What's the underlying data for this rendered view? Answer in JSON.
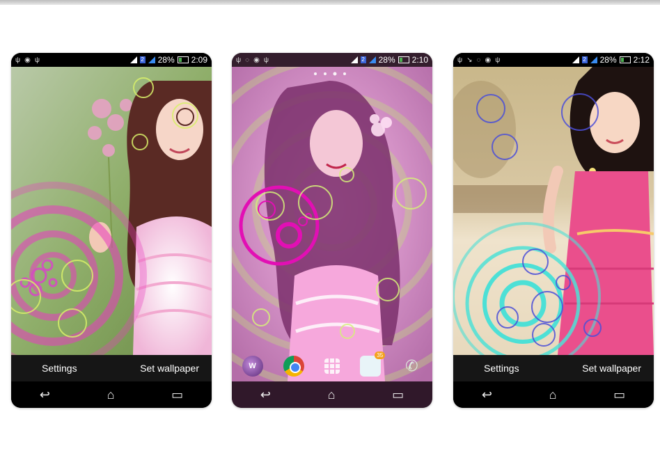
{
  "screens": [
    {
      "time": "2:09",
      "battery": "28%",
      "sim": "2",
      "actions": {
        "settings": "Settings",
        "set_wallpaper": "Set wallpaper"
      }
    },
    {
      "time": "2:10",
      "battery": "28%",
      "sim": "2",
      "dock": {
        "walkman": "W",
        "messaging_badge": "35"
      }
    },
    {
      "time": "2:12",
      "battery": "28%",
      "sim": "2",
      "actions": {
        "settings": "Settings",
        "set_wallpaper": "Set wallpaper"
      }
    }
  ],
  "nav_icons": {
    "back": "↩",
    "home": "⌂",
    "recents": "▭"
  },
  "colors": {
    "ripple_pink": "#e83cc0",
    "ripple_cyan": "#4de0d6",
    "ripple_blue": "#4b4fd8"
  }
}
